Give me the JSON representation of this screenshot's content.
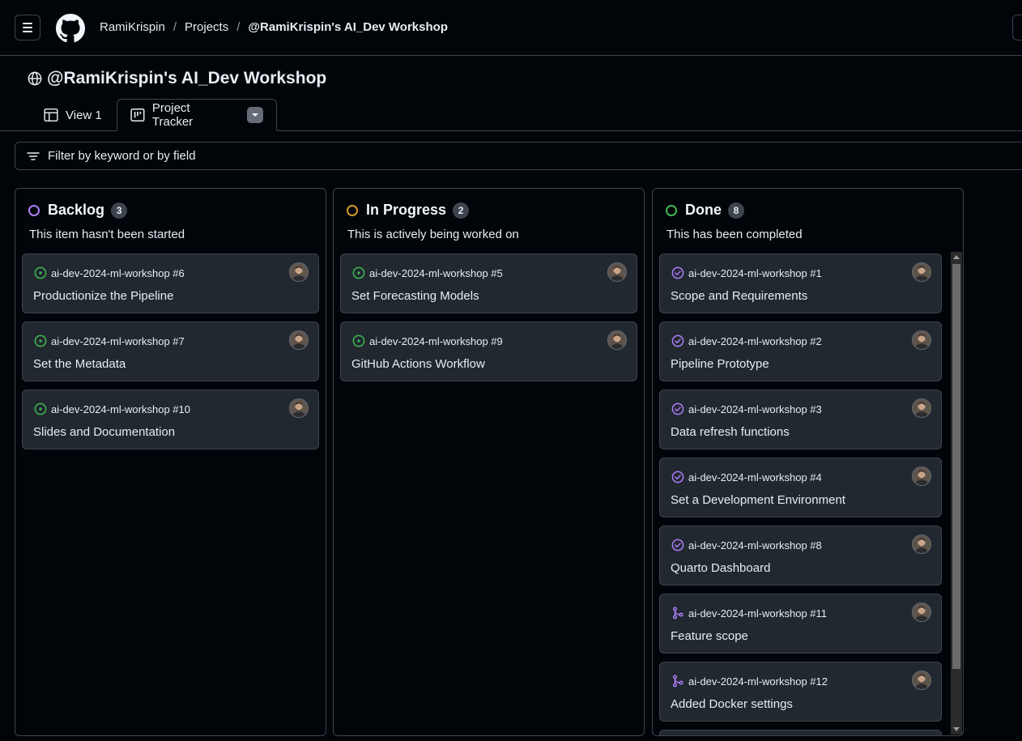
{
  "header": {
    "breadcrumbs": [
      {
        "label": "RamiKrispin"
      },
      {
        "label": "Projects"
      },
      {
        "label": "@RamiKrispin's AI_Dev Workshop"
      }
    ],
    "separator": "/"
  },
  "project": {
    "title": "@RamiKrispin's AI_Dev Workshop",
    "tabs": [
      {
        "label": "View 1",
        "icon": "table-icon",
        "active": false
      },
      {
        "label": "Project Tracker",
        "icon": "board-icon",
        "active": true
      }
    ]
  },
  "filter": {
    "placeholder": "Filter by keyword or by field"
  },
  "colors": {
    "backlog": "#ab7df8",
    "in_progress": "#d29922",
    "done": "#3fb950",
    "open_issue": "#3fb950",
    "closed_issue": "#ab7df8",
    "merged_pr": "#ab7df8"
  },
  "columns": [
    {
      "name": "Backlog",
      "count": "3",
      "description": "This item hasn't been started",
      "cards": [
        {
          "ref": "ai-dev-2024-ml-workshop #6",
          "title": "Productionize the Pipeline",
          "icon": "issue-open-icon"
        },
        {
          "ref": "ai-dev-2024-ml-workshop #7",
          "title": "Set the Metadata",
          "icon": "issue-open-icon"
        },
        {
          "ref": "ai-dev-2024-ml-workshop #10",
          "title": "Slides and Documentation",
          "icon": "issue-open-icon"
        }
      ]
    },
    {
      "name": "In Progress",
      "count": "2",
      "description": "This is actively being worked on",
      "cards": [
        {
          "ref": "ai-dev-2024-ml-workshop #5",
          "title": "Set Forecasting Models",
          "icon": "issue-open-icon"
        },
        {
          "ref": "ai-dev-2024-ml-workshop #9",
          "title": "GitHub Actions Workflow",
          "icon": "issue-open-icon"
        }
      ]
    },
    {
      "name": "Done",
      "count": "8",
      "description": "This has been completed",
      "cards": [
        {
          "ref": "ai-dev-2024-ml-workshop #1",
          "title": "Scope and Requirements",
          "icon": "issue-closed-icon"
        },
        {
          "ref": "ai-dev-2024-ml-workshop #2",
          "title": "Pipeline Prototype",
          "icon": "issue-closed-icon"
        },
        {
          "ref": "ai-dev-2024-ml-workshop #3",
          "title": "Data refresh functions",
          "icon": "issue-closed-icon"
        },
        {
          "ref": "ai-dev-2024-ml-workshop #4",
          "title": "Set a Development Environment",
          "icon": "issue-closed-icon"
        },
        {
          "ref": "ai-dev-2024-ml-workshop #8",
          "title": "Quarto Dashboard",
          "icon": "issue-closed-icon"
        },
        {
          "ref": "ai-dev-2024-ml-workshop #11",
          "title": "Feature scope",
          "icon": "pr-merged-icon"
        },
        {
          "ref": "ai-dev-2024-ml-workshop #12",
          "title": "Added Docker settings",
          "icon": "pr-merged-icon"
        }
      ]
    }
  ]
}
